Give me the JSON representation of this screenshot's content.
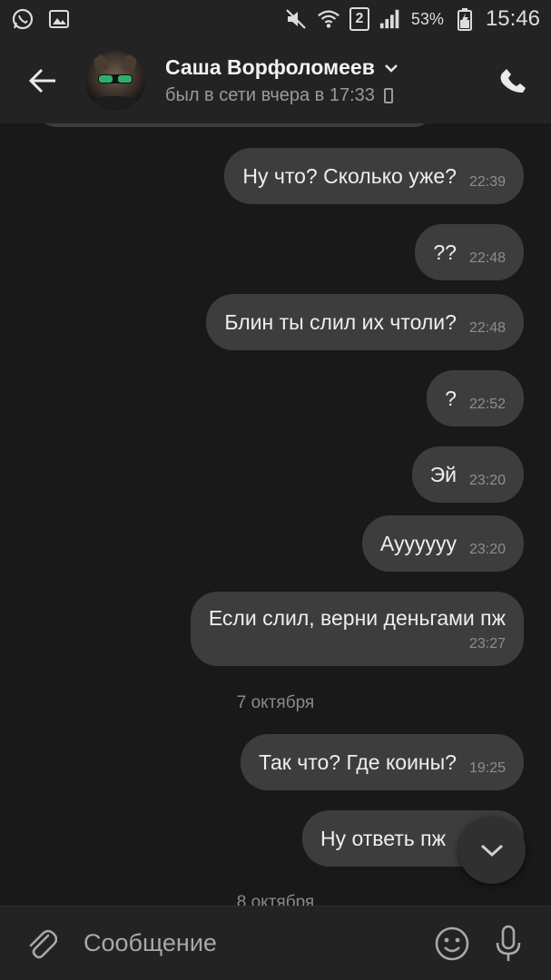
{
  "status_bar": {
    "sim_slot": "2",
    "battery": "53%",
    "time": "15:46"
  },
  "header": {
    "contact_name": "Саша Ворфоломеев",
    "contact_status": "был в сети вчера в 17:33"
  },
  "messages": [
    {
      "text": "Ну что? Сколько уже?",
      "time": "22:39"
    },
    {
      "text": "??",
      "time": "22:48"
    },
    {
      "text": "Блин ты слил их чтоли?",
      "time": "22:48"
    },
    {
      "text": "?",
      "time": "22:52"
    },
    {
      "text": "Эй",
      "time": "23:20"
    },
    {
      "text": "Ауууууу",
      "time": "23:20"
    },
    {
      "text": "Если слил, верни деньгами пж",
      "time": "23:27"
    },
    {
      "text": "Так что? Где коины?",
      "time": "19:25"
    },
    {
      "text": "Ну ответь пж",
      "time": ""
    }
  ],
  "date_separators": [
    "7 октября",
    "8 октября"
  ],
  "composer": {
    "placeholder": "Сообщение"
  },
  "colors": {
    "background": "#191919",
    "bar": "#232323",
    "bubble": "#3d3d3d"
  }
}
